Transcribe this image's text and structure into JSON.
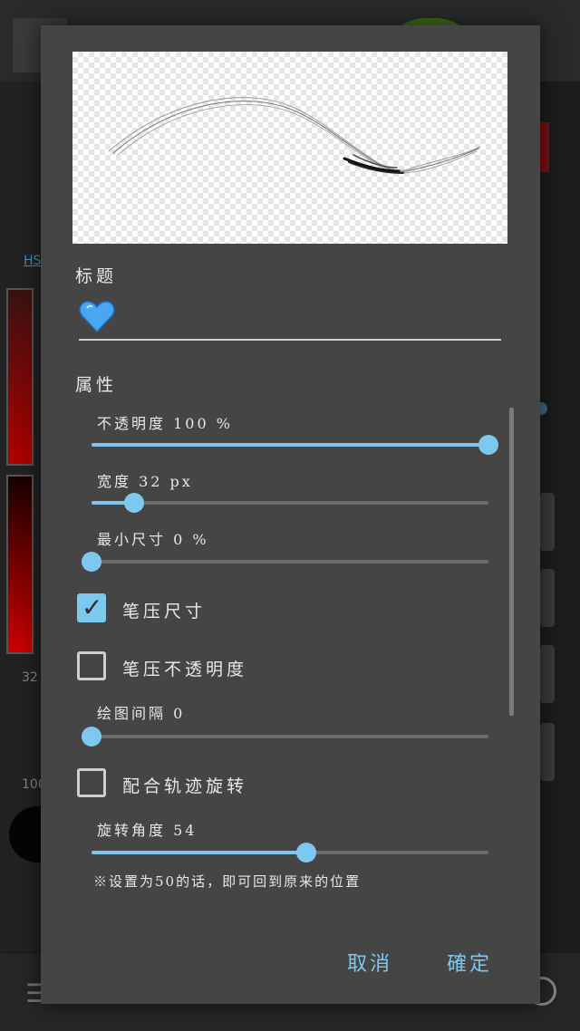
{
  "background": {
    "hs_link": "HS",
    "size_value": "32",
    "opacity_value": "100"
  },
  "dialog": {
    "title_label": "标题",
    "title_value": "💙",
    "properties_label": "属性",
    "opacity": {
      "label": "不透明度 100 %",
      "value_percent": 100
    },
    "width": {
      "label": "宽度 32 px",
      "value": 32,
      "max": 300
    },
    "min_size": {
      "label": "最小尺寸 0 %",
      "value_percent": 0
    },
    "pen_pressure_size": {
      "label": "笔压尺寸",
      "checked": true
    },
    "pen_pressure_opacity": {
      "label": "笔压不透明度",
      "checked": false
    },
    "draw_spacing": {
      "label": "绘图间隔 0",
      "value": 0
    },
    "follow_track_rotation": {
      "label": "配合轨迹旋转",
      "checked": false
    },
    "rotation_angle": {
      "label": "旋转角度 54",
      "value": 54,
      "max": 100
    },
    "note": "※设置为50的话，即可回到原来的位置",
    "cancel_label": "取消",
    "ok_label": "確定"
  },
  "colors": {
    "accent": "#7ec8ef",
    "dialog_bg": "#454545",
    "text": "#e8e8e8"
  }
}
